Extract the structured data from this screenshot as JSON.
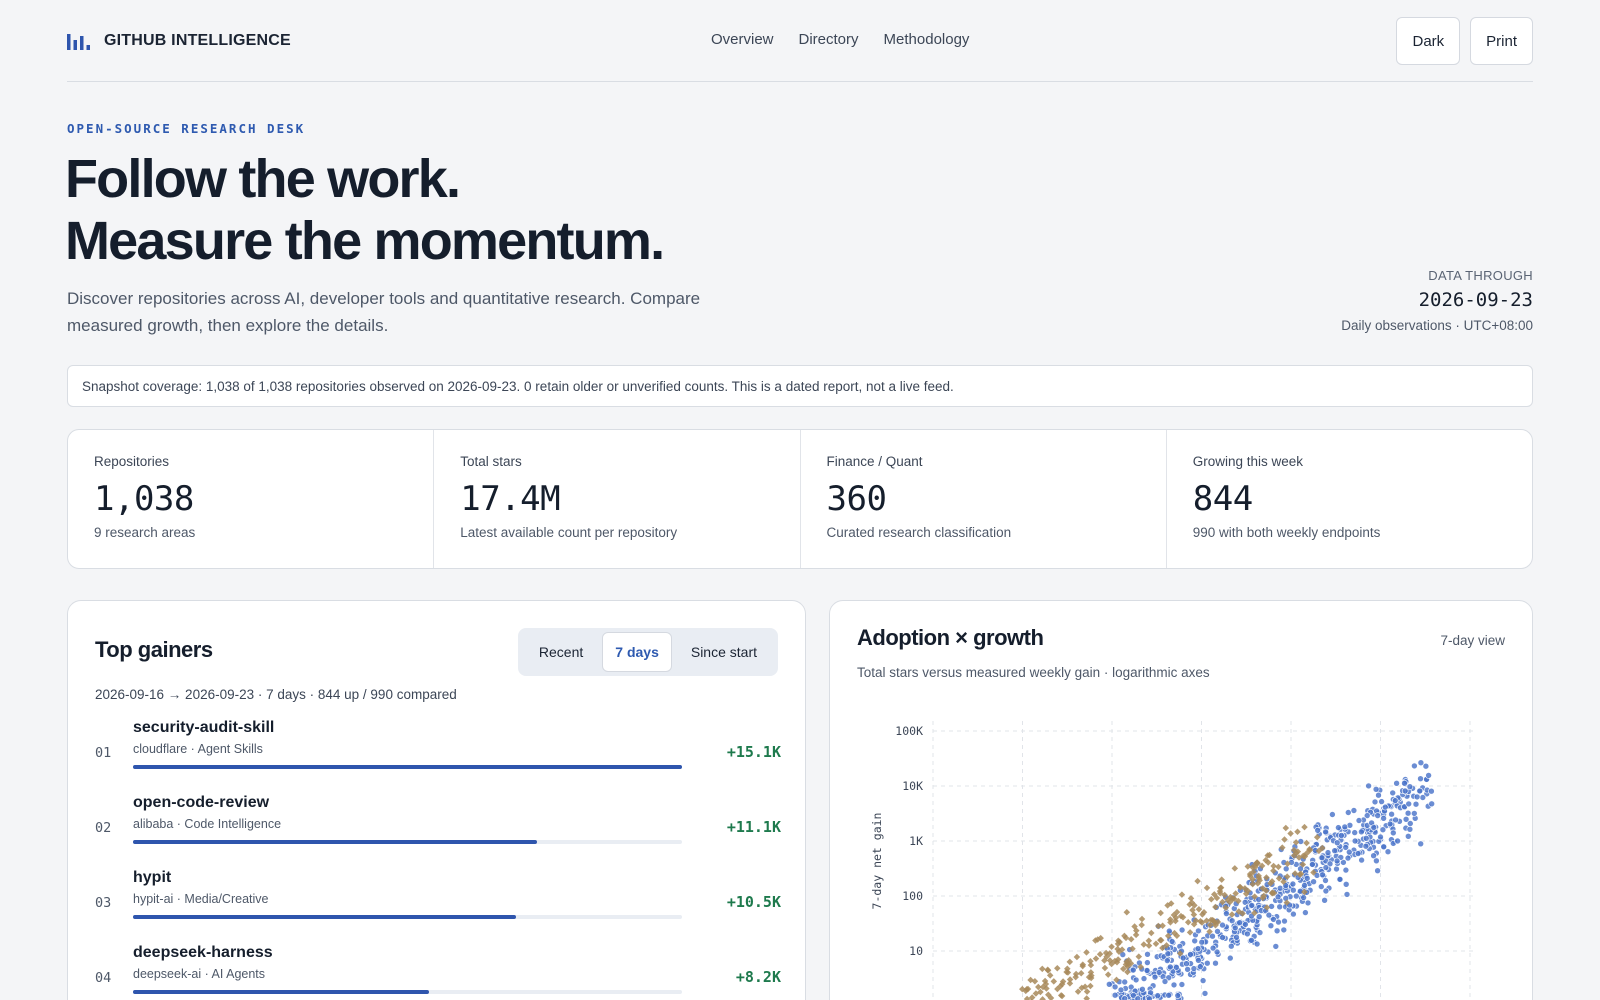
{
  "header": {
    "brand": "GITHUB INTELLIGENCE",
    "nav": [
      "Overview",
      "Directory",
      "Methodology"
    ],
    "dark_label": "Dark",
    "print_label": "Print"
  },
  "hero": {
    "eyebrow": "OPEN-SOURCE RESEARCH DESK",
    "title_line1": "Follow the work.",
    "title_line2": "Measure the momentum.",
    "description": "Discover repositories across AI, developer tools and quantitative research. Compare measured growth, then explore the details.",
    "data_through_label": "DATA THROUGH",
    "data_through_date": "2026-09-23",
    "data_through_sub": "Daily observations · UTC+08:00"
  },
  "coverage": "Snapshot coverage: 1,038 of 1,038 repositories observed on 2026-09-23. 0 retain older or unverified counts. This is a dated report, not a live feed.",
  "stats": [
    {
      "label": "Repositories",
      "value": "1,038",
      "sub": "9 research areas"
    },
    {
      "label": "Total stars",
      "value": "17.4M",
      "sub": "Latest available count per repository"
    },
    {
      "label": "Finance / Quant",
      "value": "360",
      "sub": "Curated research classification"
    },
    {
      "label": "Growing this week",
      "value": "844",
      "sub": "990 with both weekly endpoints"
    }
  ],
  "gainers": {
    "title": "Top gainers",
    "tabs": [
      "Recent",
      "7 days",
      "Since start"
    ],
    "active_tab": "7 days",
    "range": "2026-09-16 → 2026-09-23 · 7 days · 844 up / 990 compared",
    "rows": [
      {
        "rank": "01",
        "name": "security-audit-skill",
        "meta": "cloudflare · Agent Skills",
        "gain": "+15.1K",
        "share": 1.0
      },
      {
        "rank": "02",
        "name": "open-code-review",
        "meta": "alibaba · Code Intelligence",
        "gain": "+11.1K",
        "share": 0.735
      },
      {
        "rank": "03",
        "name": "hypit",
        "meta": "hypit-ai · Media/Creative",
        "gain": "+10.5K",
        "share": 0.698
      },
      {
        "rank": "04",
        "name": "deepseek-harness",
        "meta": "deepseek-ai · AI Agents",
        "gain": "+8.2K",
        "share": 0.54
      }
    ]
  },
  "adoption": {
    "title": "Adoption × growth",
    "subtitle": "Total stars versus measured weekly gain · logarithmic axes",
    "view": "7-day view"
  },
  "chart_data": {
    "type": "scatter",
    "title": "Adoption × growth",
    "xlabel": "",
    "ylabel": "7-day net gain",
    "y_scale": "log",
    "x_scale": "log",
    "y_ticks": [
      "10",
      "100",
      "1K",
      "10K",
      "100K"
    ],
    "grid": true,
    "series": [
      {
        "color": "#4b74c9",
        "marker": "circle",
        "points": "approximately 600 repositories, concentrated from ~30 to ~10K weekly gain"
      },
      {
        "color": "#a88a5a",
        "marker": "diamond",
        "points": "approximately 250 repositories, concentrated from ~5 to ~1K weekly gain"
      }
    ]
  }
}
